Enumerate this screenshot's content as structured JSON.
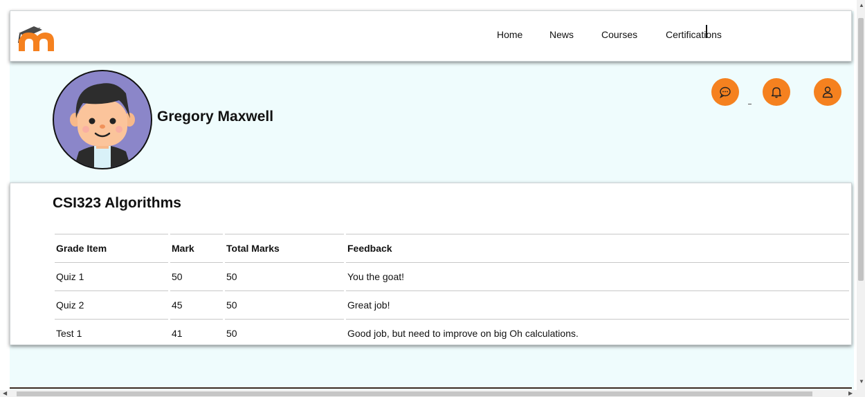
{
  "nav": {
    "links": [
      "Home",
      "News",
      "Courses",
      "Certifications"
    ]
  },
  "profile": {
    "name": "Gregory Maxwell"
  },
  "actions": {
    "icons": [
      "chat-icon",
      "bell-icon",
      "user-icon"
    ],
    "accent_color": "#f5811f"
  },
  "course": {
    "title": "CSI323 Algorithms",
    "columns": [
      "Grade Item",
      "Mark",
      "Total Marks",
      "Feedback"
    ],
    "rows": [
      [
        "Quiz 1",
        "50",
        "50",
        "You the goat!"
      ],
      [
        "Quiz 2",
        "45",
        "50",
        "Great job!"
      ],
      [
        "Test 1",
        "41",
        "50",
        "Good job, but need to improve on big Oh calculations."
      ]
    ]
  }
}
